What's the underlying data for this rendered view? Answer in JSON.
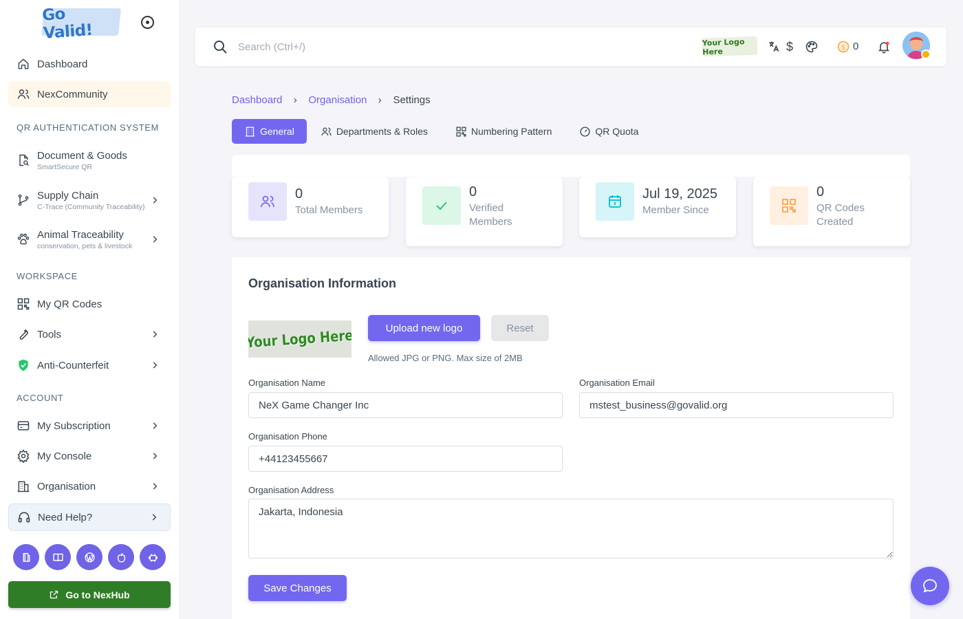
{
  "brand": {
    "logo_text": "Go Valid!"
  },
  "sidebar": {
    "items": [
      {
        "label": "Dashboard"
      },
      {
        "label": "NexCommunity"
      },
      {
        "label": "Document & Goods",
        "sub": "SmartSecure QR"
      },
      {
        "label": "Supply Chain",
        "sub": "C-Trace (Community Traceability)"
      },
      {
        "label": "Animal Traceability",
        "sub": "conservation, pets & livestock"
      },
      {
        "label": "My QR Codes"
      },
      {
        "label": "Tools"
      },
      {
        "label": "Anti-Counterfeit"
      },
      {
        "label": "My Subscription"
      },
      {
        "label": "My Console"
      },
      {
        "label": "Organisation"
      },
      {
        "label": "Need Help?"
      }
    ],
    "sections": {
      "qr_auth": "QR AUTHENTICATION SYSTEM",
      "workspace": "WORKSPACE",
      "account": "ACCOUNT"
    },
    "bottom_icons": [
      "book-icon",
      "open-book-icon",
      "wordpress-icon",
      "apple-icon",
      "android-icon"
    ],
    "nexhub_label": "Go to NexHub"
  },
  "topbar": {
    "search_placeholder": "Search (Ctrl+/)",
    "logo_text": "Your Logo Here",
    "currency_symbol": "$",
    "coin_count": "0"
  },
  "breadcrumb": {
    "items": [
      "Dashboard",
      "Organisation",
      "Settings"
    ]
  },
  "tabs": [
    "General",
    "Departments & Roles",
    "Numbering Pattern",
    "QR Quota"
  ],
  "active_tab": "General",
  "stats": [
    {
      "value": "0",
      "label": "Total Members",
      "color": "#7367f0"
    },
    {
      "value": "0",
      "label": "Verified Members",
      "color": "#28c76f"
    },
    {
      "value": "Jul 19, 2025",
      "label": "Member Since",
      "color": "#00bad1"
    },
    {
      "value": "0",
      "label": "QR Codes Created",
      "color": "#ff9f43"
    }
  ],
  "org": {
    "title": "Organisation Information",
    "logo_text": "Your Logo Here",
    "upload_label": "Upload new logo",
    "reset_label": "Reset",
    "upload_hint": "Allowed JPG or PNG. Max size of 2MB",
    "name_label": "Organisation Name",
    "name_value": "NeX Game Changer Inc",
    "email_label": "Organisation Email",
    "email_value": "mstest_business@govalid.org",
    "phone_label": "Organisation Phone",
    "phone_value": "+44123455667",
    "address_label": "Organisation Address",
    "address_value": "Jakarta, Indonesia",
    "save_label": "Save Changes"
  },
  "colors": {
    "primary": "#7367f0",
    "nexhub_green": "#2f7d27"
  }
}
